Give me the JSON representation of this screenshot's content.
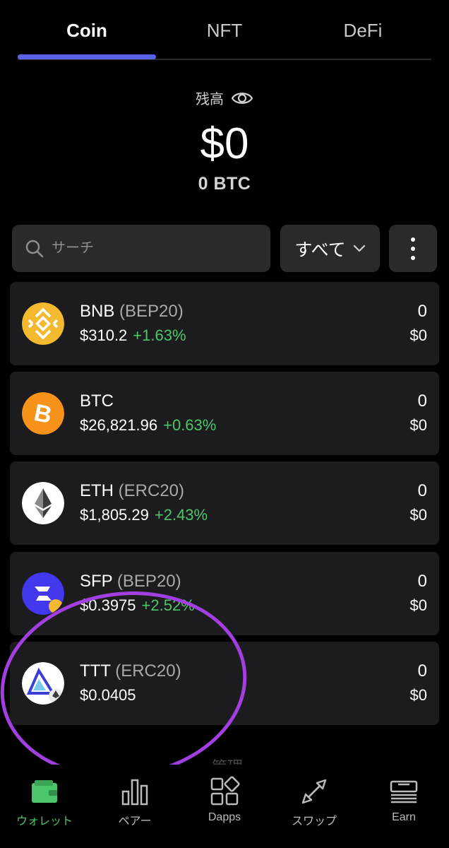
{
  "tabs": {
    "coin": "Coin",
    "nft": "NFT",
    "defi": "DeFi"
  },
  "balance": {
    "label": "残高",
    "usd": "$0",
    "btc": "0 BTC"
  },
  "search": {
    "placeholder": "サーチ"
  },
  "filter": {
    "label": "すべて"
  },
  "coins": [
    {
      "symbol": "BNB",
      "network": "(BEP20)",
      "price": "$310.2",
      "change": "+1.63%",
      "amount": "0",
      "value": "$0",
      "icon": "bnb-logo",
      "color": "#f3ba2f"
    },
    {
      "symbol": "BTC",
      "network": "",
      "price": "$26,821.96",
      "change": "+0.63%",
      "amount": "0",
      "value": "$0",
      "icon": "btc-logo",
      "color": "#f7931a"
    },
    {
      "symbol": "ETH",
      "network": "(ERC20)",
      "price": "$1,805.29",
      "change": "+2.43%",
      "amount": "0",
      "value": "$0",
      "icon": "eth-logo",
      "color": "#ffffff"
    },
    {
      "symbol": "SFP",
      "network": "(BEP20)",
      "price": "$0.3975",
      "change": "+2.52%",
      "amount": "0",
      "value": "$0",
      "icon": "sfp-logo",
      "color": "#4338ed"
    },
    {
      "symbol": "TTT",
      "network": "(ERC20)",
      "price": "$0.0405",
      "change": "",
      "amount": "0",
      "value": "$0",
      "icon": "ttt-logo",
      "color": "#ffffff"
    }
  ],
  "partial_text": "管理",
  "nav": {
    "wallet": "ウォレット",
    "pair": "ペアー",
    "dapps": "Dapps",
    "swap": "スワップ",
    "earn": "Earn"
  },
  "colors": {
    "accent": "#5b61e8",
    "positive": "#4cc66a",
    "highlight": "#a23fe0",
    "card": "#1c1c1e"
  }
}
